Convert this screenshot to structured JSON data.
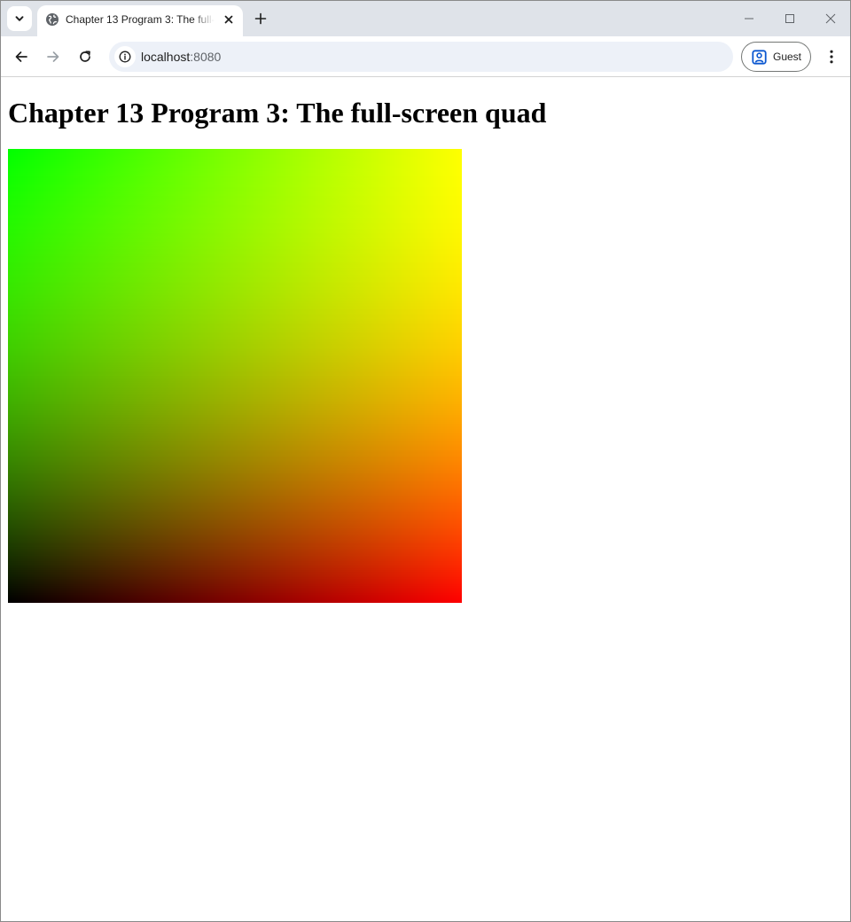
{
  "browser": {
    "tab": {
      "title": "Chapter 13 Program 3: The full-screen quad",
      "close_symbol": "✕"
    },
    "new_tab_symbol": "+",
    "address": {
      "host": "localhost",
      "port": ":8080"
    },
    "profile_label": "Guest",
    "icons": {
      "tab_search": "chevron-down-icon",
      "favicon": "globe-icon",
      "back": "arrow-left-icon",
      "forward": "arrow-right-icon",
      "reload": "reload-icon",
      "site_info": "info-icon",
      "profile": "person-badge-icon",
      "menu": "more-vert-icon",
      "minimize": "minimize-icon",
      "maximize": "maximize-icon",
      "close": "close-icon"
    }
  },
  "page": {
    "heading": "Chapter 13 Program 3: The full-screen quad",
    "canvas": {
      "corner_colors": {
        "top_left": "#00ff00",
        "top_right": "#ffff00",
        "bottom_left": "#000000",
        "bottom_right": "#ff0000"
      }
    }
  },
  "colors": {
    "tabstrip": "#dfe3e9",
    "omnibox": "#edf1f8",
    "profile_icon": "#0b57d0"
  }
}
